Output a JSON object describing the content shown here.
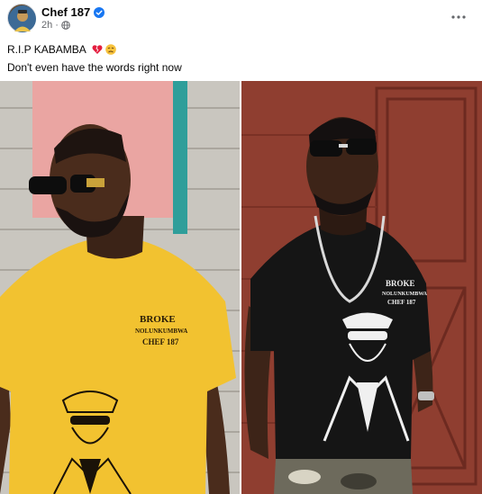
{
  "post": {
    "author": "Chef 187",
    "time": "2h",
    "text_line1": "R.I.P KABAMBA",
    "text_line2": "Don't even have the words right now",
    "emojis": [
      "broken-heart",
      "sad-face"
    ]
  },
  "photos": [
    {
      "shirt_text": [
        "BROKE",
        "NOLUNKUMBWA",
        "CHEF 187"
      ],
      "shirt_color": "#f2c230"
    },
    {
      "shirt_text": [
        "BROKE",
        "NOLUNKUMBWA",
        "CHEF 187"
      ],
      "shirt_color": "#151515"
    }
  ],
  "colors": {
    "verified": "#1877f2",
    "meta": "#65676b",
    "wall_right": "#8a3b2e"
  }
}
